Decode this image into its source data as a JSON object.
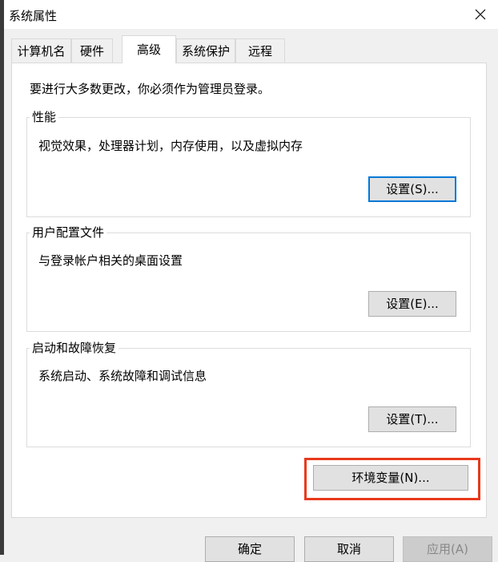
{
  "window": {
    "title": "系统属性"
  },
  "tabs": [
    {
      "label": "计算机名",
      "active": false
    },
    {
      "label": "硬件",
      "active": false
    },
    {
      "label": "高级",
      "active": true
    },
    {
      "label": "系统保护",
      "active": false
    },
    {
      "label": "远程",
      "active": false
    }
  ],
  "advanced": {
    "admin_notice": "要进行大多数更改，你必须作为管理员登录。",
    "performance": {
      "title": "性能",
      "description": "视觉效果，处理器计划，内存使用，以及虚拟内存",
      "button": "设置(S)..."
    },
    "user_profiles": {
      "title": "用户配置文件",
      "description": "与登录帐户相关的桌面设置",
      "button": "设置(E)..."
    },
    "startup_recovery": {
      "title": "启动和故障恢复",
      "description": "系统启动、系统故障和调试信息",
      "button": "设置(T)..."
    },
    "env_vars_button": "环境变量(N)..."
  },
  "footer": {
    "ok": "确定",
    "cancel": "取消",
    "apply": "应用(A)"
  },
  "colors": {
    "highlight": "#e8391c",
    "focus": "#0078d7"
  },
  "icons": {
    "close": "close-icon"
  }
}
